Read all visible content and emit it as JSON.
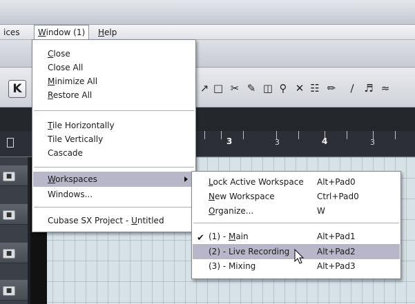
{
  "menubar": {
    "partial_label": "ices",
    "window_label": "Window (1)",
    "help_label": "Help"
  },
  "window_menu": {
    "items": [
      {
        "label": "Close"
      },
      {
        "label": "Close All"
      },
      {
        "label": "Minimize All"
      },
      {
        "label": "Restore All"
      },
      {
        "label": "Tile Horizontally"
      },
      {
        "label": "Tile Vertically"
      },
      {
        "label": "Cascade"
      },
      {
        "label": "Workspaces"
      },
      {
        "label": "Windows..."
      },
      {
        "label": "Cubase SX Project - Untitled"
      }
    ]
  },
  "workspaces_menu": {
    "items": [
      {
        "label": "Lock Active Workspace",
        "shortcut": "Alt+Pad0"
      },
      {
        "label": "New Workspace",
        "shortcut": "Ctrl+Pad0"
      },
      {
        "label": "Organize...",
        "shortcut": "W"
      },
      {
        "label": "(1) - Main",
        "shortcut": "Alt+Pad1",
        "checked": true
      },
      {
        "label": "(2) - Live Recording",
        "shortcut": "Alt+Pad2"
      },
      {
        "label": "(3) - Mixing",
        "shortcut": "Alt+Pad3"
      }
    ]
  },
  "ruler": {
    "labels": [
      "3",
      "3",
      "4",
      "3"
    ]
  },
  "toolbar": {
    "k_label": "K"
  }
}
